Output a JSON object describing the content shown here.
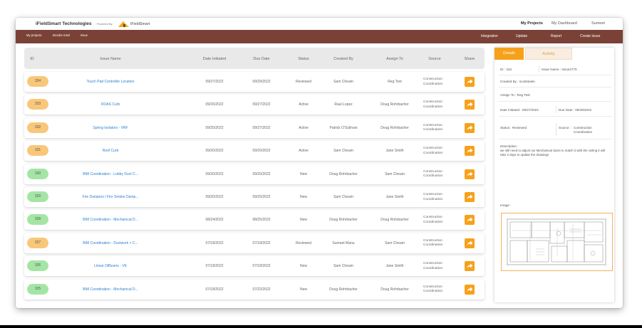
{
  "header": {
    "company": "iFieldSmart Technologies",
    "powered_by": "Powered By",
    "logo_text": "iFieldSmart",
    "nav": [
      "My Projects",
      "My Dashboard",
      "Sumeet"
    ]
  },
  "navbar": {
    "left": [
      "My projects",
      "Brooks Hotel",
      "Issue"
    ],
    "right": [
      "Integration",
      "Update",
      "Report",
      "Create Issue"
    ]
  },
  "table": {
    "columns": [
      "ID",
      "Issue Name",
      "Date Initiated",
      "Due Date",
      "Status",
      "Created By",
      "Assign To",
      "Source",
      "Share"
    ],
    "rows": [
      {
        "id": "334",
        "name": "Touch Pad Controller Location",
        "date": "09/27/2022",
        "due": "09/29/2022",
        "status": "Reviewed",
        "created": "Sam Cheam",
        "assign": "Reg Test",
        "source": "Construction Coordination",
        "badge": "orange"
      },
      {
        "id": "333",
        "name": "DOAS Curb",
        "date": "09/26/2022",
        "due": "09/27/2022",
        "status": "Active",
        "created": "Raul Lopez",
        "assign": "Doug Rohrbacher",
        "source": "Construction Coordination",
        "badge": "orange"
      },
      {
        "id": "332",
        "name": "Spring Isolators - VRF",
        "date": "09/25/2022",
        "due": "09/27/2022",
        "status": "Active",
        "created": "Patrick O'Sullivan",
        "assign": "Doug Rohrbacher",
        "source": "Construction Coordination",
        "badge": "orange"
      },
      {
        "id": "331",
        "name": "Roof Curb",
        "date": "09/20/2022",
        "due": "09/20/2022",
        "status": "Active",
        "created": "Sam Cheam",
        "assign": "Jane Smith",
        "source": "Construction Coordination",
        "badge": "orange"
      },
      {
        "id": "330",
        "name": "BIM Coordination - Lobby Duct C...",
        "date": "09/20/2022",
        "due": "09/20/2022",
        "status": "New",
        "created": "Doug Rohrbacher",
        "assign": "Sam Cheam",
        "source": "Construction Coordination",
        "badge": "green"
      },
      {
        "id": "329",
        "name": "Fire Dampers / Fire Smoke Damp...",
        "date": "09/20/2022",
        "due": "09/20/2022",
        "status": "New",
        "created": "Sam Cheam",
        "assign": "Jane Smith",
        "source": "Construction Coordination",
        "badge": "green"
      },
      {
        "id": "328",
        "name": "BIM Coordination - Mechanical D...",
        "date": "08/24/2022",
        "due": "08/25/2022",
        "status": "New",
        "created": "Doug Rohrbacher",
        "assign": "Doug Rohrbacher",
        "source": "Construction Coordination",
        "badge": "green"
      },
      {
        "id": "327",
        "name": "BIM Coordination - Ductwork + C...",
        "date": "07/18/2022",
        "due": "07/18/2022",
        "status": "Reviewed",
        "created": "Sumeet Manu",
        "assign": "Sam Cheam",
        "source": "Construction Coordination",
        "badge": "orange"
      },
      {
        "id": "326",
        "name": "Linear Diffusers - VE",
        "date": "07/18/2022",
        "due": "07/18/2022",
        "status": "New",
        "created": "Sam Cheam",
        "assign": "Jane Smith",
        "source": "Construction Coordination",
        "badge": "green"
      },
      {
        "id": "325",
        "name": "BIM Coordination - Mechanical D...",
        "date": "07/18/2022",
        "due": "07/22/2022",
        "status": "New",
        "created": "Doug Rohrbacher",
        "assign": "Doug Rohrbacher",
        "source": "Construction Coordination",
        "badge": "green"
      }
    ]
  },
  "details": {
    "tab_details": "Details",
    "tab_activity": "Activity",
    "id": "ID : 334",
    "issue_name": "Issue Name : Issue2770",
    "created_by": "Created By : scottsteele",
    "assign_to": "Assign To : Reg Test",
    "date_initiated": "Date Initiated : 09/27/2022",
    "due_date": "Due Date : 09/29/2022",
    "status": "Status : Reviewed",
    "source_label": "Source :",
    "source_line1": "Construction",
    "source_line2": "Coordination",
    "description_label": "Description :",
    "description": "we still need to adjust our Mechanical ducts to match it with the ceiling it will take 2 days to update the drawings",
    "image_label": "Image :"
  },
  "colors": {
    "navbar": "#7a4236",
    "accent": "#f6a11a",
    "badge_orange": "#f8c779",
    "badge_green": "#a4e5a6",
    "link": "#2b7fd0"
  }
}
